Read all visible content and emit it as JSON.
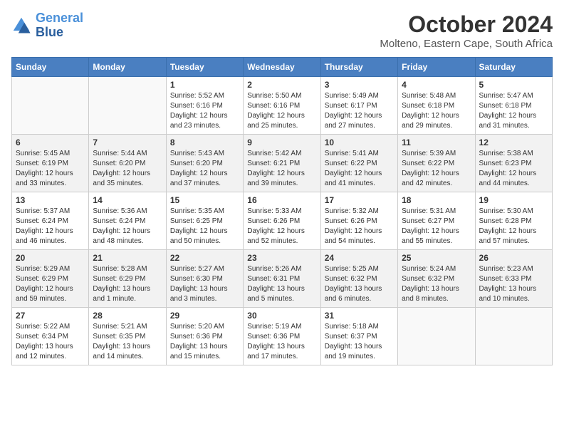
{
  "logo": {
    "line1": "General",
    "line2": "Blue"
  },
  "title": "October 2024",
  "subtitle": "Molteno, Eastern Cape, South Africa",
  "headers": [
    "Sunday",
    "Monday",
    "Tuesday",
    "Wednesday",
    "Thursday",
    "Friday",
    "Saturday"
  ],
  "weeks": [
    [
      {
        "day": "",
        "info": ""
      },
      {
        "day": "",
        "info": ""
      },
      {
        "day": "1",
        "info": "Sunrise: 5:52 AM\nSunset: 6:16 PM\nDaylight: 12 hours and 23 minutes."
      },
      {
        "day": "2",
        "info": "Sunrise: 5:50 AM\nSunset: 6:16 PM\nDaylight: 12 hours and 25 minutes."
      },
      {
        "day": "3",
        "info": "Sunrise: 5:49 AM\nSunset: 6:17 PM\nDaylight: 12 hours and 27 minutes."
      },
      {
        "day": "4",
        "info": "Sunrise: 5:48 AM\nSunset: 6:18 PM\nDaylight: 12 hours and 29 minutes."
      },
      {
        "day": "5",
        "info": "Sunrise: 5:47 AM\nSunset: 6:18 PM\nDaylight: 12 hours and 31 minutes."
      }
    ],
    [
      {
        "day": "6",
        "info": "Sunrise: 5:45 AM\nSunset: 6:19 PM\nDaylight: 12 hours and 33 minutes."
      },
      {
        "day": "7",
        "info": "Sunrise: 5:44 AM\nSunset: 6:20 PM\nDaylight: 12 hours and 35 minutes."
      },
      {
        "day": "8",
        "info": "Sunrise: 5:43 AM\nSunset: 6:20 PM\nDaylight: 12 hours and 37 minutes."
      },
      {
        "day": "9",
        "info": "Sunrise: 5:42 AM\nSunset: 6:21 PM\nDaylight: 12 hours and 39 minutes."
      },
      {
        "day": "10",
        "info": "Sunrise: 5:41 AM\nSunset: 6:22 PM\nDaylight: 12 hours and 41 minutes."
      },
      {
        "day": "11",
        "info": "Sunrise: 5:39 AM\nSunset: 6:22 PM\nDaylight: 12 hours and 42 minutes."
      },
      {
        "day": "12",
        "info": "Sunrise: 5:38 AM\nSunset: 6:23 PM\nDaylight: 12 hours and 44 minutes."
      }
    ],
    [
      {
        "day": "13",
        "info": "Sunrise: 5:37 AM\nSunset: 6:24 PM\nDaylight: 12 hours and 46 minutes."
      },
      {
        "day": "14",
        "info": "Sunrise: 5:36 AM\nSunset: 6:24 PM\nDaylight: 12 hours and 48 minutes."
      },
      {
        "day": "15",
        "info": "Sunrise: 5:35 AM\nSunset: 6:25 PM\nDaylight: 12 hours and 50 minutes."
      },
      {
        "day": "16",
        "info": "Sunrise: 5:33 AM\nSunset: 6:26 PM\nDaylight: 12 hours and 52 minutes."
      },
      {
        "day": "17",
        "info": "Sunrise: 5:32 AM\nSunset: 6:26 PM\nDaylight: 12 hours and 54 minutes."
      },
      {
        "day": "18",
        "info": "Sunrise: 5:31 AM\nSunset: 6:27 PM\nDaylight: 12 hours and 55 minutes."
      },
      {
        "day": "19",
        "info": "Sunrise: 5:30 AM\nSunset: 6:28 PM\nDaylight: 12 hours and 57 minutes."
      }
    ],
    [
      {
        "day": "20",
        "info": "Sunrise: 5:29 AM\nSunset: 6:29 PM\nDaylight: 12 hours and 59 minutes."
      },
      {
        "day": "21",
        "info": "Sunrise: 5:28 AM\nSunset: 6:29 PM\nDaylight: 13 hours and 1 minute."
      },
      {
        "day": "22",
        "info": "Sunrise: 5:27 AM\nSunset: 6:30 PM\nDaylight: 13 hours and 3 minutes."
      },
      {
        "day": "23",
        "info": "Sunrise: 5:26 AM\nSunset: 6:31 PM\nDaylight: 13 hours and 5 minutes."
      },
      {
        "day": "24",
        "info": "Sunrise: 5:25 AM\nSunset: 6:32 PM\nDaylight: 13 hours and 6 minutes."
      },
      {
        "day": "25",
        "info": "Sunrise: 5:24 AM\nSunset: 6:32 PM\nDaylight: 13 hours and 8 minutes."
      },
      {
        "day": "26",
        "info": "Sunrise: 5:23 AM\nSunset: 6:33 PM\nDaylight: 13 hours and 10 minutes."
      }
    ],
    [
      {
        "day": "27",
        "info": "Sunrise: 5:22 AM\nSunset: 6:34 PM\nDaylight: 13 hours and 12 minutes."
      },
      {
        "day": "28",
        "info": "Sunrise: 5:21 AM\nSunset: 6:35 PM\nDaylight: 13 hours and 14 minutes."
      },
      {
        "day": "29",
        "info": "Sunrise: 5:20 AM\nSunset: 6:36 PM\nDaylight: 13 hours and 15 minutes."
      },
      {
        "day": "30",
        "info": "Sunrise: 5:19 AM\nSunset: 6:36 PM\nDaylight: 13 hours and 17 minutes."
      },
      {
        "day": "31",
        "info": "Sunrise: 5:18 AM\nSunset: 6:37 PM\nDaylight: 13 hours and 19 minutes."
      },
      {
        "day": "",
        "info": ""
      },
      {
        "day": "",
        "info": ""
      }
    ]
  ]
}
